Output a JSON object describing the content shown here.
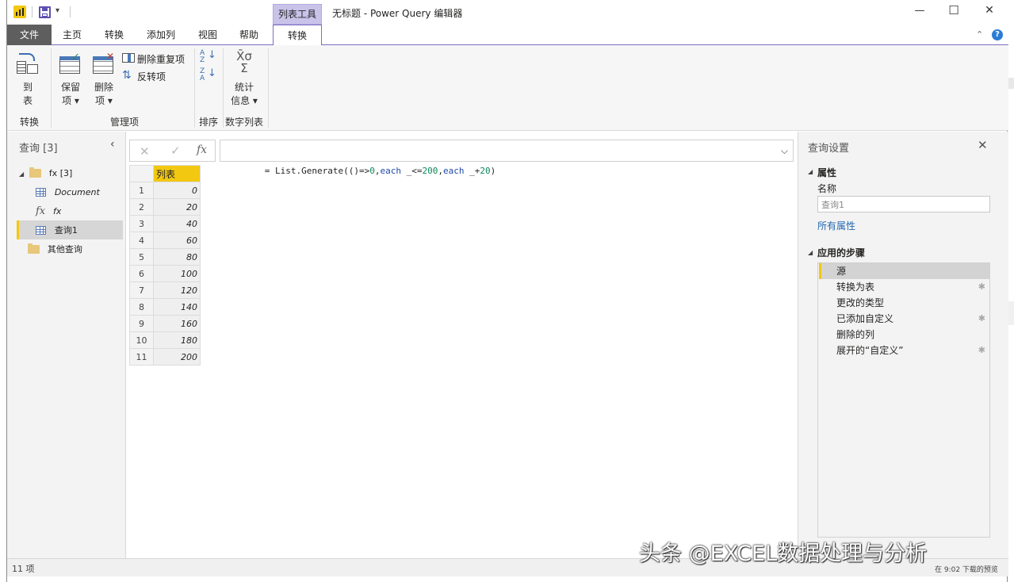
{
  "window": {
    "title": "无标题 - Power Query 编辑器",
    "context_tab_group": "列表工具",
    "controls": {
      "minimize": "—",
      "maximize": "☐",
      "close": "✕"
    }
  },
  "tabs": [
    {
      "label": "文件"
    },
    {
      "label": "主页"
    },
    {
      "label": "转换"
    },
    {
      "label": "添加列"
    },
    {
      "label": "视图"
    },
    {
      "label": "帮助"
    },
    {
      "label": "转换"
    }
  ],
  "ribbon": {
    "to_table": {
      "line1": "到",
      "line2": "表"
    },
    "keep_items": {
      "line1": "保留",
      "line2": "项 ▾"
    },
    "remove_items": {
      "line1": "删除",
      "line2": "项 ▾"
    },
    "remove_duplicates": "删除重复项",
    "reverse_items": "反转项",
    "statistics": {
      "line1": "统计",
      "line2": "信息 ▾"
    },
    "groups": [
      "转换",
      "管理项",
      "排序",
      "数字列表"
    ]
  },
  "queries_panel": {
    "title": "查询 [3]",
    "items": [
      {
        "label": "fx [3]",
        "type": "folder"
      },
      {
        "label": "Document",
        "type": "table"
      },
      {
        "label": "fx",
        "type": "function"
      },
      {
        "label": "查询1",
        "type": "table",
        "selected": true
      },
      {
        "label": "其他查询",
        "type": "folder"
      }
    ]
  },
  "formula_bar": {
    "cancel": "✕",
    "commit": "✓",
    "fx": "fx",
    "formula_parts": {
      "p1": "= List.Generate(()=>",
      "p2": "0",
      "p3": ",",
      "p4": "each",
      "p5": " _<=",
      "p6": "200",
      "p7": ",",
      "p8": "each",
      "p9": " _+",
      "p10": "20",
      "p11": ")"
    }
  },
  "grid": {
    "column_header": "列表",
    "rows": [
      {
        "n": "1",
        "v": "0"
      },
      {
        "n": "2",
        "v": "20"
      },
      {
        "n": "3",
        "v": "40"
      },
      {
        "n": "4",
        "v": "60"
      },
      {
        "n": "5",
        "v": "80"
      },
      {
        "n": "6",
        "v": "100"
      },
      {
        "n": "7",
        "v": "120"
      },
      {
        "n": "8",
        "v": "140"
      },
      {
        "n": "9",
        "v": "160"
      },
      {
        "n": "10",
        "v": "180"
      },
      {
        "n": "11",
        "v": "200"
      }
    ]
  },
  "settings_panel": {
    "title": "查询设置",
    "properties_header": "属性",
    "name_label": "名称",
    "name_value": "查询1",
    "all_properties": "所有属性",
    "steps_header": "应用的步骤",
    "steps": [
      {
        "label": "源",
        "gear": false
      },
      {
        "label": "转换为表",
        "gear": true
      },
      {
        "label": "更改的类型",
        "gear": false
      },
      {
        "label": "已添加自定义",
        "gear": true
      },
      {
        "label": "删除的列",
        "gear": false
      },
      {
        "label": "展开的“自定义”",
        "gear": true
      }
    ]
  },
  "status_bar": {
    "left": "11 项",
    "right": "在 9:02 下载的预览"
  },
  "watermark": "头条 @EXCEL数据处理与分析",
  "colors": {
    "accent": "#7b6ec0",
    "context_tab": "#c9c3ea",
    "column_header": "#f2c811",
    "file_tab": "#5e5e5e",
    "link": "#2468b0"
  }
}
